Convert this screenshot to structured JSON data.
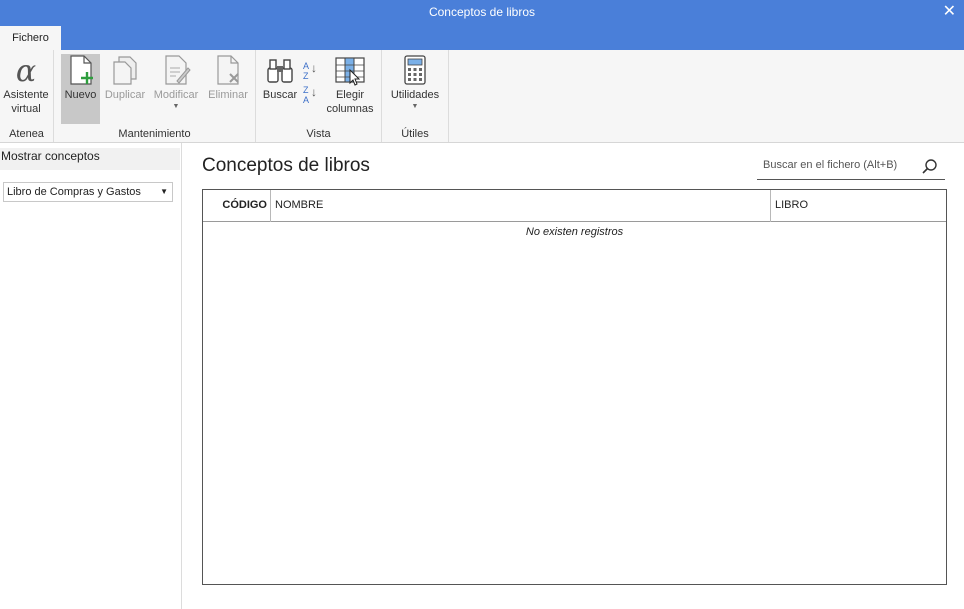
{
  "window": {
    "title": "Conceptos de libros"
  },
  "tabs": [
    {
      "label": "Fichero"
    }
  ],
  "ribbon": {
    "atenea": {
      "label": "Atenea",
      "assistant": {
        "line1": "Asistente",
        "line2": "virtual"
      }
    },
    "mantenimiento": {
      "label": "Mantenimiento",
      "buttons": [
        {
          "label": "Nuevo"
        },
        {
          "label": "Duplicar"
        },
        {
          "label": "Modificar"
        },
        {
          "label": "Eliminar"
        }
      ]
    },
    "vista": {
      "label": "Vista",
      "buscar": "Buscar",
      "sort_asc": {
        "top": "A",
        "bottom": "Z"
      },
      "sort_desc": {
        "top": "Z",
        "bottom": "A"
      },
      "elegir": {
        "line1": "Elegir",
        "line2": "columnas"
      }
    },
    "utiles": {
      "label": "Útiles",
      "utilidades": "Utilidades"
    }
  },
  "sidebar": {
    "title": "Mostrar conceptos",
    "filter_value": "Libro de Compras y Gastos"
  },
  "main": {
    "title": "Conceptos de libros",
    "search_placeholder": "Buscar en el fichero (Alt+B)",
    "columns": [
      "CÓDIGO",
      "NOMBRE",
      "LIBRO"
    ],
    "empty_message": "No existen registros"
  },
  "colors": {
    "titlebar": "#4a7fd9",
    "accent_green": "#2e9e3e"
  }
}
